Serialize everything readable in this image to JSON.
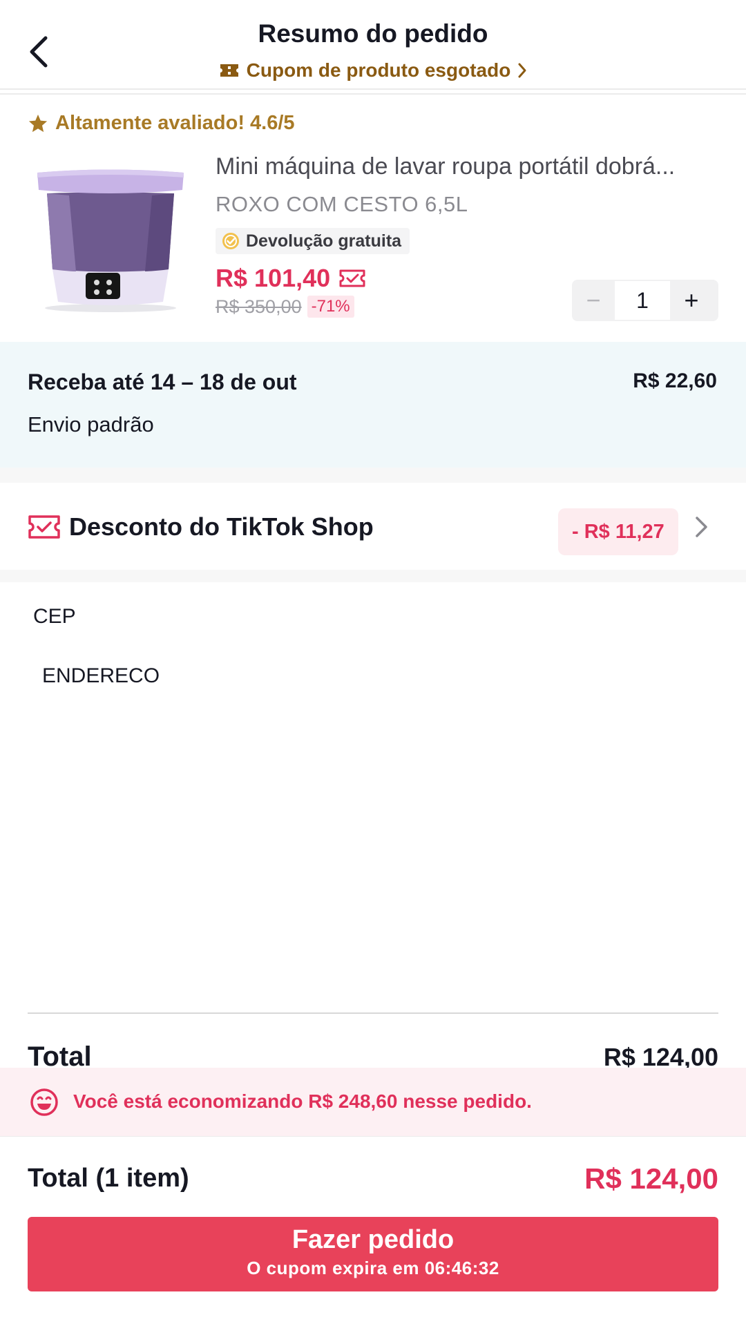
{
  "header": {
    "title": "Resumo do pedido",
    "coupon_text": "Cupom de produto esgotado"
  },
  "product": {
    "rating_text": "Altamente avaliado! 4.6/5",
    "title": "Mini máquina de lavar roupa portátil dobrá...",
    "variant": "ROXO  COM CESTO 6,5L",
    "return_badge": "Devolução gratuita",
    "price": "R$ 101,40",
    "original_price": "R$ 350,00",
    "discount_percent": "-71%",
    "quantity": "1",
    "qty_minus": "−",
    "qty_plus": "+"
  },
  "shipping": {
    "title": "Receba até 14 – 18 de out",
    "price": "R$ 22,60",
    "method": "Envio padrão"
  },
  "discount": {
    "label": "Desconto do TikTok Shop",
    "value": "- R$ 11,27"
  },
  "address": {
    "cep": "CEP",
    "endereco": "ENDERECO"
  },
  "totals": {
    "label": "Total",
    "value": "R$ 124,00"
  },
  "savings": {
    "text": "Você está economizando R$ 248,60 nesse pedido."
  },
  "bottom": {
    "total_label": "Total (1 item)",
    "total_value": "R$ 124,00",
    "button_label": "Fazer pedido",
    "button_sub": "O cupom expira em 06:46:32"
  },
  "colors": {
    "accent": "#e8425a",
    "price_red": "#e0305a",
    "coupon_brown": "#8a5a12",
    "rating_gold": "#a87a26",
    "shipping_bg": "#f0f8fa",
    "product_lavender": "#c7b3e6"
  },
  "icons": {
    "back": "chevron-left-icon",
    "coupon": "ticket-icon",
    "rating": "star-icon",
    "return": "check-badge-icon",
    "price_coupon": "ticket-check-icon",
    "discount": "ticket-check-icon",
    "discount_chevron": "chevron-right-icon",
    "savings": "smile-icon"
  }
}
